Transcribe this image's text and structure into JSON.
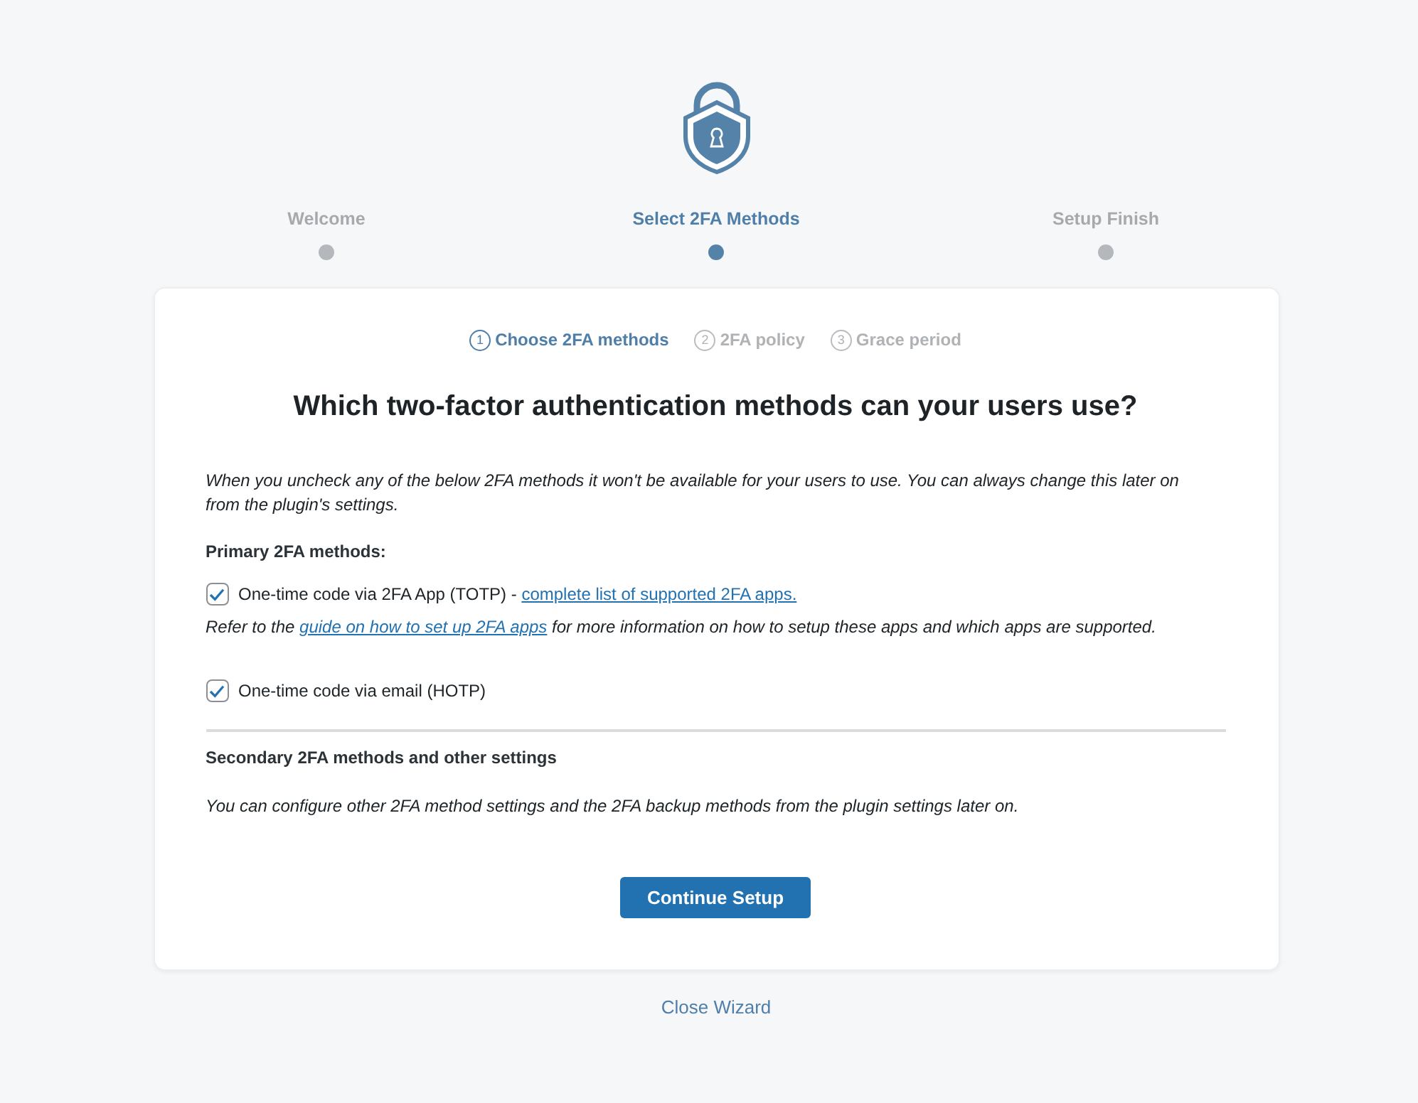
{
  "steps": [
    {
      "label": "Welcome",
      "selected": false
    },
    {
      "label": "Select 2FA Methods",
      "selected": true
    },
    {
      "label": "Setup Finish",
      "selected": false
    }
  ],
  "substeps": [
    {
      "number": "1",
      "label": "Choose 2FA methods",
      "selected": true
    },
    {
      "number": "2",
      "label": "2FA policy",
      "selected": false
    },
    {
      "number": "3",
      "label": "Grace period",
      "selected": false
    }
  ],
  "heading": "Which two-factor authentication methods can your users use?",
  "intro": "When you uncheck any of the below 2FA methods it won't be available for your users to use. You can always change this later on from the plugin's settings.",
  "primary": {
    "title": "Primary 2FA methods:",
    "methods": [
      {
        "label": "One-time code via 2FA App (TOTP) - ",
        "link": "complete list of supported 2FA apps.",
        "checked": true,
        "note": {
          "before": "Refer to the ",
          "link": "guide on how to set up 2FA apps",
          "after": " for more information on how to setup these apps and which apps are supported."
        }
      },
      {
        "label": "One-time code via email (HOTP)",
        "checked": true
      }
    ]
  },
  "secondary": {
    "title": "Secondary 2FA methods and other settings",
    "text": "You can configure other 2FA method settings and the 2FA backup methods from the plugin settings later on."
  },
  "button": "Continue Setup",
  "close_link": "Close Wizard"
}
